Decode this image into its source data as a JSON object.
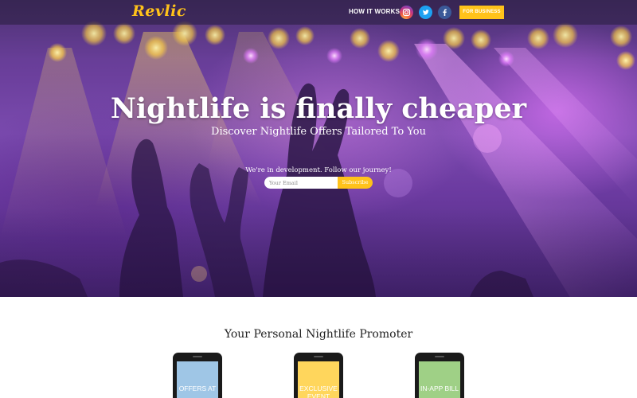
{
  "header": {
    "logo_text": "Revlic",
    "nav_how_it_works": "HOW IT WORKS",
    "social_icons": [
      "instagram-icon",
      "twitter-icon",
      "facebook-icon"
    ],
    "business_button": "FOR BUSINESS"
  },
  "hero": {
    "title": "Nightlife is finally cheaper",
    "subtitle": "Discover Nightlife Offers Tailored To You",
    "dev_note": "We're in development. Follow our journey!",
    "email_placeholder": "Your Email",
    "email_value": "",
    "subscribe_label": "Subscribe"
  },
  "features": {
    "title": "Your Personal Nightlife Promoter",
    "cards": [
      {
        "label": "OFFERS AT"
      },
      {
        "label": "EXCLUSIVE EVENT"
      },
      {
        "label": "IN-APP BILL"
      }
    ]
  },
  "colors": {
    "accent": "#ffc21a",
    "hero_purple": "#6b3f9c",
    "card_blue": "#9fc6e6",
    "card_yellow": "#ffd65c",
    "card_green": "#9fd086"
  }
}
